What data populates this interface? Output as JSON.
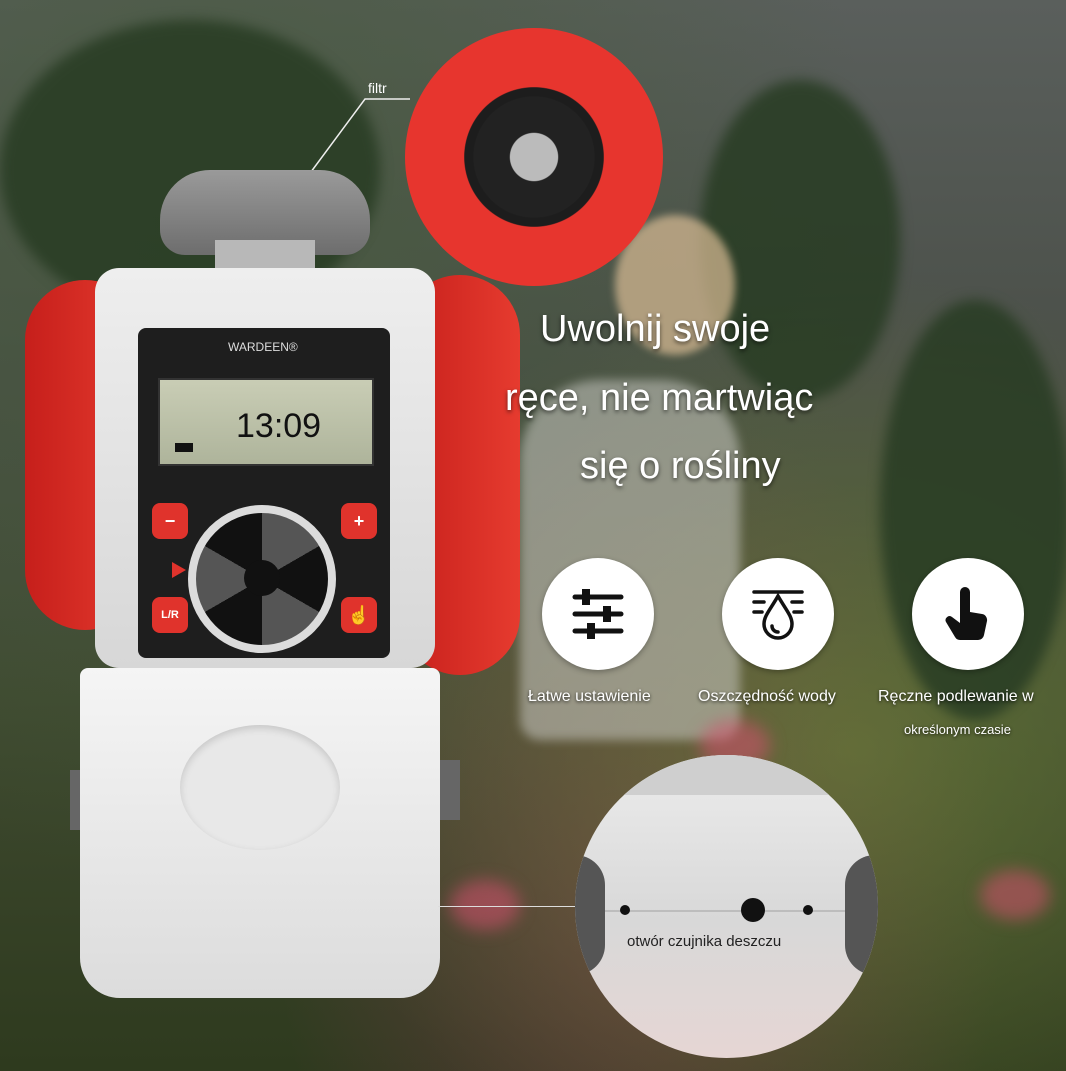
{
  "callouts": {
    "filter": "filtr",
    "rain_sensor": "otwór czujnika deszczu"
  },
  "headline": {
    "line1": "Uwolnij swoje",
    "line2": "ręce, nie martwiąc",
    "line3": "się o rośliny"
  },
  "device": {
    "brand": "WARDEEN®",
    "display_time": "13:09",
    "keys": {
      "minus": "−",
      "plus": "+",
      "lr": "L/R",
      "manual": "☝"
    }
  },
  "features": [
    {
      "icon": "sliders-icon",
      "label": "Łatwe ustawienie"
    },
    {
      "icon": "water-drop-icon",
      "label": "Oszczędność wody"
    },
    {
      "icon": "hand-tap-icon",
      "label": "Ręczne podlewanie w"
    }
  ],
  "features_extra": {
    "label3_line2": "określonym czasie"
  },
  "colors": {
    "device_red": "#e0332c",
    "device_grey": "#dcdcdc"
  }
}
